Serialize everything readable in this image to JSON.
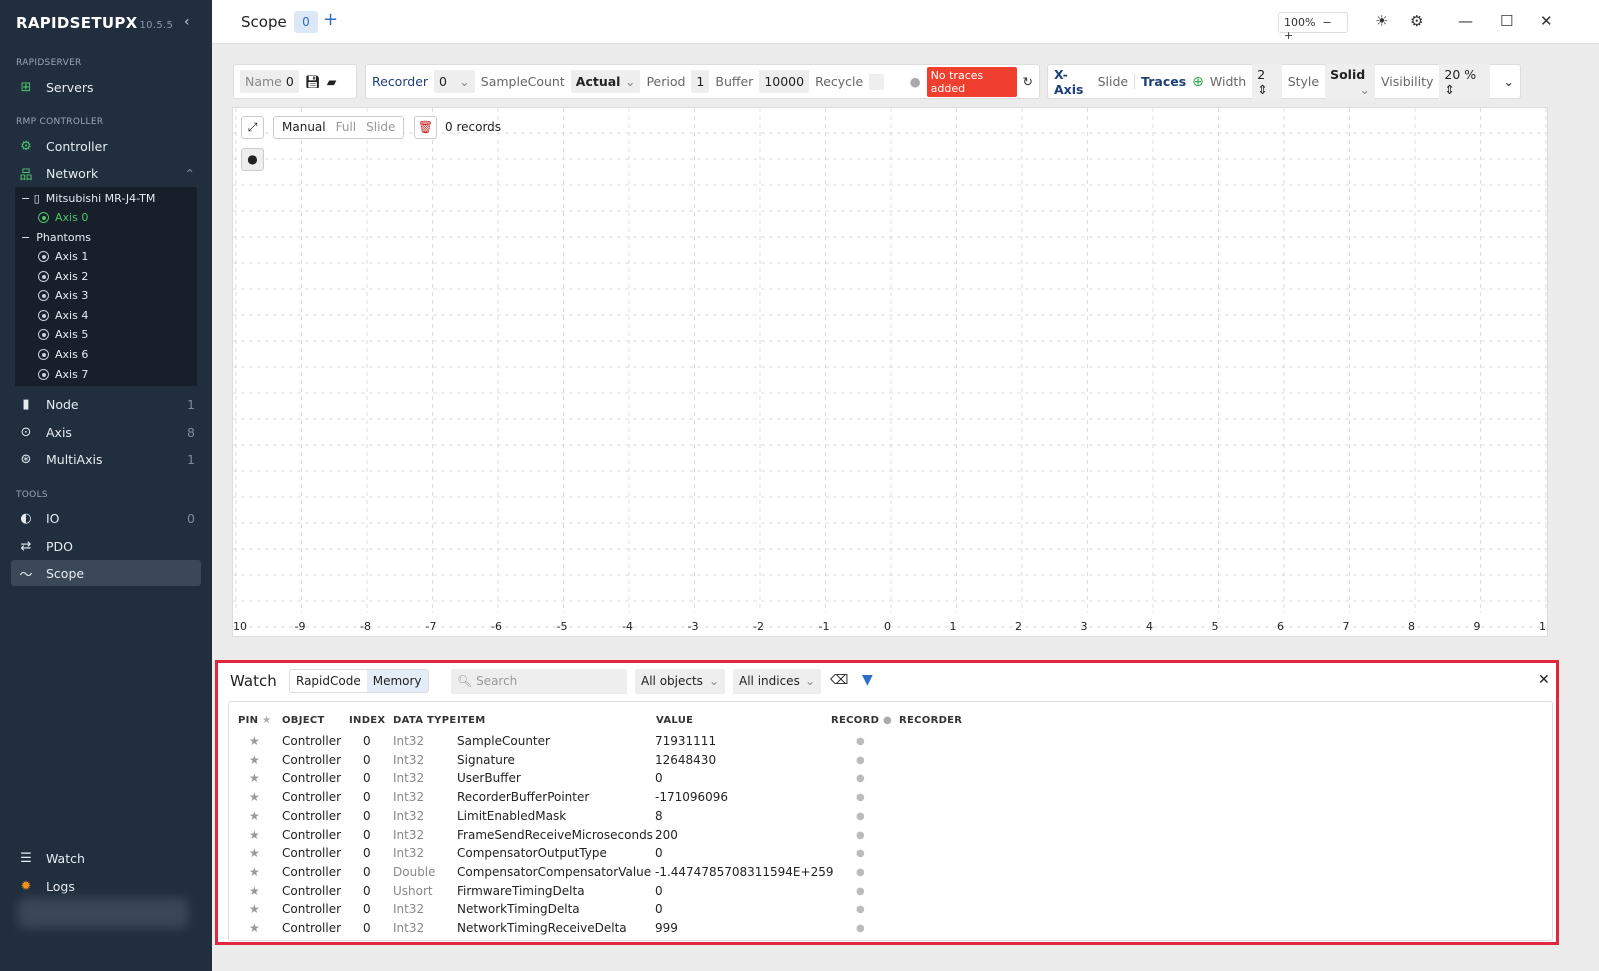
{
  "app": {
    "name": "RAPIDSETUPX",
    "version": "10.5.5"
  },
  "sidebar": {
    "sections": {
      "server": "RAPIDSERVER",
      "controller": "RMP CONTROLLER",
      "tools": "TOOLS"
    },
    "servers": "Servers",
    "controller": "Controller",
    "network": "Network",
    "tree": {
      "device": "Mitsubishi MR-J4-TM",
      "axis0": "Axis 0",
      "phantoms": "Phantoms",
      "axes": [
        "Axis 1",
        "Axis 2",
        "Axis 3",
        "Axis 4",
        "Axis 5",
        "Axis 6",
        "Axis 7"
      ]
    },
    "items": [
      {
        "label": "Node",
        "count": "1"
      },
      {
        "label": "Axis",
        "count": "8"
      },
      {
        "label": "MultiAxis",
        "count": "1"
      }
    ],
    "tools": [
      {
        "label": "IO",
        "count": "0"
      },
      {
        "label": "PDO"
      },
      {
        "label": "Scope"
      }
    ],
    "bottom": [
      {
        "label": "Watch"
      },
      {
        "label": "Logs"
      }
    ]
  },
  "titlebar": {
    "title": "Scope",
    "tab": "0",
    "zoom": "100%"
  },
  "toolbar": {
    "name_label": "Name",
    "name_value": "0",
    "recorder_label": "Recorder",
    "recorder_value": "0",
    "samplecount_label": "SampleCount",
    "samplecount_value": "Actual",
    "period_label": "Period",
    "period_value": "1",
    "buffer_label": "Buffer",
    "buffer_value": "10000",
    "recycle_label": "Recycle",
    "status_badge": "No traces added",
    "xaxis_label": "X-Axis",
    "xaxis_mode": "Slide",
    "traces_label": "Traces",
    "width_label": "Width",
    "width_value": "2",
    "style_label": "Style",
    "style_value": "Solid",
    "visibility_label": "Visibility",
    "visibility_value": "20 %"
  },
  "chart": {
    "modes": [
      "Manual",
      "Full",
      "Slide"
    ],
    "records": "0 records",
    "xticks": [
      "10",
      "-9",
      "-8",
      "-7",
      "-6",
      "-5",
      "-4",
      "-3",
      "-2",
      "-1",
      "0",
      "1",
      "2",
      "3",
      "4",
      "5",
      "6",
      "7",
      "8",
      "9",
      "1"
    ]
  },
  "watch": {
    "title": "Watch",
    "tabs": [
      "RapidCode",
      "Memory"
    ],
    "search_placeholder": "Search",
    "objects": "All objects",
    "indices": "All indices",
    "columns": [
      "PIN",
      "OBJECT",
      "INDEX",
      "DATA TYPE",
      "ITEM",
      "VALUE",
      "RECORD",
      "RECORDER"
    ],
    "rows": [
      {
        "object": "Controller",
        "index": "0",
        "type": "Int32",
        "item": "SampleCounter",
        "value": "71931111"
      },
      {
        "object": "Controller",
        "index": "0",
        "type": "Int32",
        "item": "Signature",
        "value": "12648430"
      },
      {
        "object": "Controller",
        "index": "0",
        "type": "Int32",
        "item": "UserBuffer",
        "value": "0"
      },
      {
        "object": "Controller",
        "index": "0",
        "type": "Int32",
        "item": "RecorderBufferPointer",
        "value": "-171096096"
      },
      {
        "object": "Controller",
        "index": "0",
        "type": "Int32",
        "item": "LimitEnabledMask",
        "value": "8"
      },
      {
        "object": "Controller",
        "index": "0",
        "type": "Int32",
        "item": "FrameSendReceiveMicroseconds",
        "value": "200"
      },
      {
        "object": "Controller",
        "index": "0",
        "type": "Int32",
        "item": "CompensatorOutputType",
        "value": "0"
      },
      {
        "object": "Controller",
        "index": "0",
        "type": "Double",
        "item": "CompensatorCompensatorValue",
        "value": "-1.4474785708311594E+259"
      },
      {
        "object": "Controller",
        "index": "0",
        "type": "Ushort",
        "item": "FirmwareTimingDelta",
        "value": "0"
      },
      {
        "object": "Controller",
        "index": "0",
        "type": "Int32",
        "item": "NetworkTimingDelta",
        "value": "0"
      },
      {
        "object": "Controller",
        "index": "0",
        "type": "Int32",
        "item": "NetworkTimingReceiveDelta",
        "value": "999"
      }
    ]
  },
  "colors": {
    "sidebar": "#212e3e",
    "accent": "#2c6fc9",
    "green": "#4fc46a",
    "badge": "#f03e2f",
    "highlight": "#e0283c"
  }
}
